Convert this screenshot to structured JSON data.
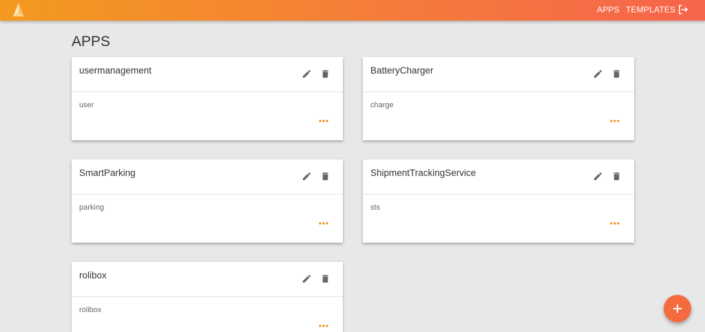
{
  "header": {
    "logo_icon": "pyramid-logo-icon",
    "nav": {
      "apps_label": "APPS",
      "templates_label": "TEMPLATES"
    },
    "logout_icon": "logout-icon",
    "gradient_colors": [
      "#f39a1e",
      "#f7644c"
    ]
  },
  "main": {
    "title": "APPS",
    "apps": [
      {
        "name": "usermanagement",
        "description": "user"
      },
      {
        "name": "BatteryCharger",
        "description": "charge"
      },
      {
        "name": "SmartParking",
        "description": "parking"
      },
      {
        "name": "ShipmentTrackingService",
        "description": "sts"
      },
      {
        "name": "rolibox",
        "description": "rolibox"
      }
    ],
    "card_icons": [
      "edit-icon",
      "delete-icon",
      "more-icon"
    ],
    "accent_color": "#f5890f"
  },
  "fab": {
    "icon": "plus-icon",
    "color": "#f46b40"
  }
}
